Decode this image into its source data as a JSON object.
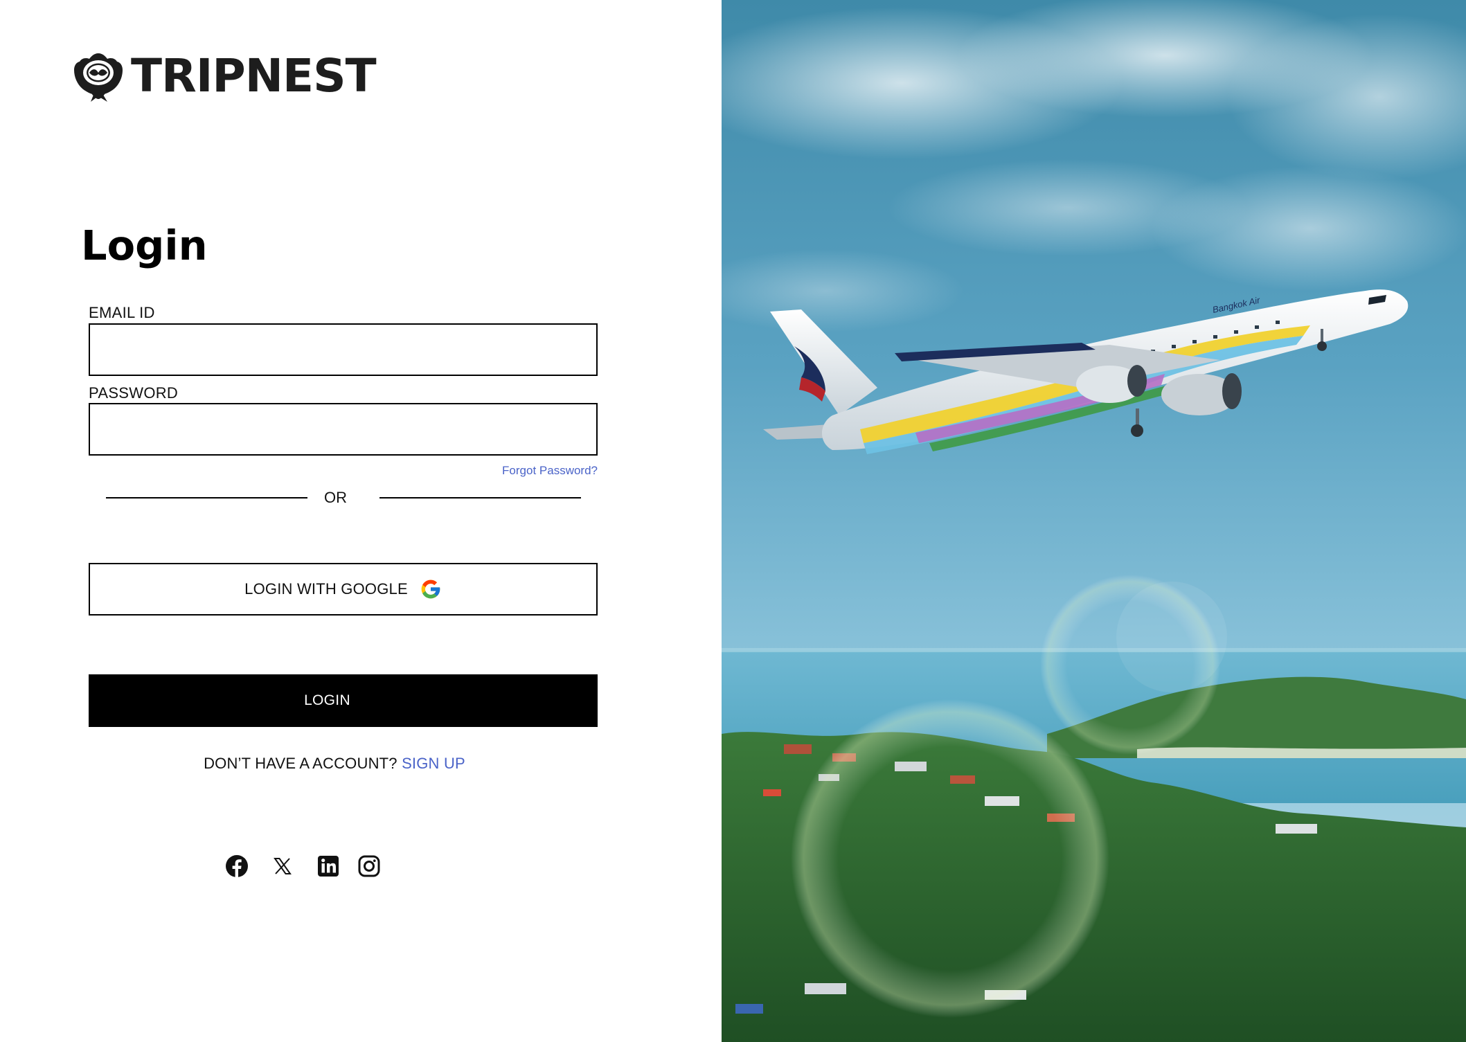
{
  "brand": {
    "name": "TRIPNEST",
    "logo_icon": "tripnest-logo-icon"
  },
  "login": {
    "title": "Login",
    "email_label": "EMAIL ID",
    "email_value": "",
    "password_label": "PASSWORD",
    "password_value": "",
    "forgot_password": "Forgot Password?",
    "divider_text": "OR",
    "google_button": "LOGIN WITH GOOGLE",
    "google_icon": "google-g-icon",
    "login_button": "LOGIN",
    "no_account_text": "DON’T HAVE A ACCOUNT?",
    "signup_link": "SIGN UP"
  },
  "social": [
    {
      "name": "facebook",
      "icon": "facebook-icon"
    },
    {
      "name": "x",
      "icon": "x-icon"
    },
    {
      "name": "linkedin",
      "icon": "linkedin-icon"
    },
    {
      "name": "instagram",
      "icon": "instagram-icon"
    }
  ],
  "hero": {
    "scene": "airplane-over-tropical-coast-photo",
    "aircraft_livery_text": "Bangkok Air"
  },
  "colors": {
    "link": "#4a63c8",
    "primary_button": "#000000",
    "text": "#111111",
    "sky": "#4d95b8"
  }
}
